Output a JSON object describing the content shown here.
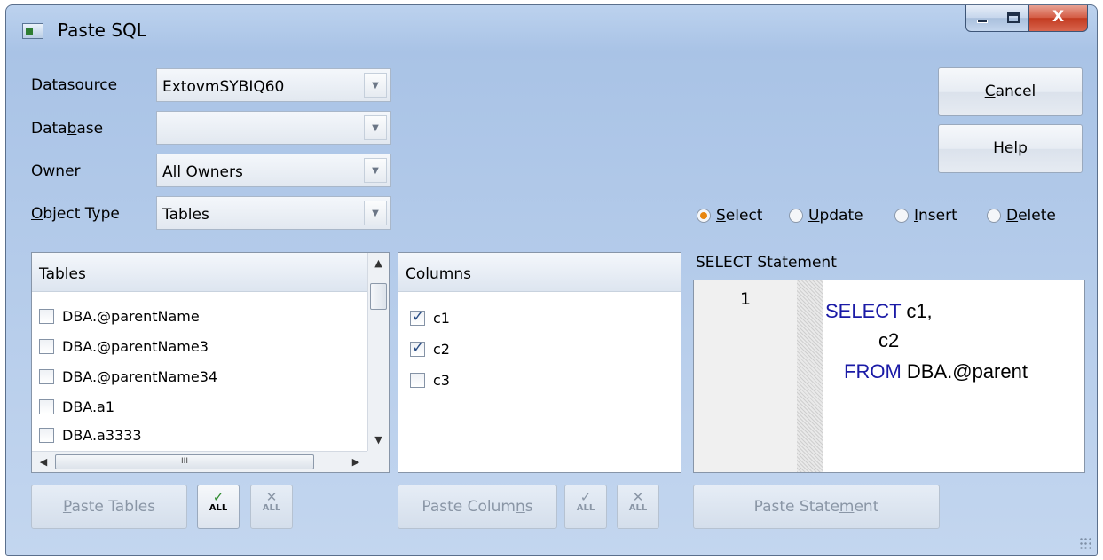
{
  "window": {
    "title": "Paste SQL",
    "close_glyph": "X"
  },
  "form": {
    "datasource": {
      "label_pre": "Da",
      "label_key": "t",
      "label_post": "asource",
      "value": "ExtovmSYBIQ60"
    },
    "database": {
      "label_pre": "Data",
      "label_key": "b",
      "label_post": "ase",
      "value": ""
    },
    "owner": {
      "label_pre": "O",
      "label_key": "w",
      "label_post": "ner",
      "value": "All Owners"
    },
    "object_type": {
      "label_pre": "",
      "label_key": "O",
      "label_post": "bject Type",
      "value": "Tables"
    }
  },
  "buttons": {
    "cancel": {
      "key": "C",
      "rest": "ancel"
    },
    "help": {
      "key": "H",
      "rest": "elp"
    },
    "paste_tables": {
      "key": "P",
      "rest": "aste Tables"
    },
    "paste_columns": {
      "pre": "Paste Colum",
      "key": "n",
      "post": "s"
    },
    "paste_statement": {
      "pre": "Paste State",
      "key": "m",
      "post": "ent"
    },
    "check_all_label": "ALL",
    "uncheck_all_label": "ALL"
  },
  "statement_types": [
    {
      "key": "S",
      "rest": "elect",
      "selected": true
    },
    {
      "key": "U",
      "rest": "pdate",
      "selected": false
    },
    {
      "key": "I",
      "rest": "nsert",
      "selected": false
    },
    {
      "key": "D",
      "rest": "elete",
      "selected": false
    }
  ],
  "tables": {
    "header": "Tables",
    "items": [
      {
        "name": "DBA.@parentName",
        "checked": false
      },
      {
        "name": "DBA.@parentName3",
        "checked": false
      },
      {
        "name": "DBA.@parentName34",
        "checked": false
      },
      {
        "name": "DBA.a1",
        "checked": false
      },
      {
        "name": "DBA.a3333",
        "checked": false
      }
    ],
    "hscroll_thumb_label": "III"
  },
  "columns": {
    "header": "Columns",
    "items": [
      {
        "name": "c1",
        "checked": true
      },
      {
        "name": "c2",
        "checked": true
      },
      {
        "name": "c3",
        "checked": false
      }
    ]
  },
  "statement": {
    "label": "SELECT Statement",
    "line_number": "1",
    "line1_kw": "SELECT",
    "line1_rest": "c1,",
    "line2": "c2",
    "line3_kw": "FROM",
    "line3_rest": "DBA.@parent"
  },
  "colors": {
    "keyword": "#1a1aa6",
    "radio_selected": "#e8860f",
    "check_icon": "#2e8b2e"
  }
}
